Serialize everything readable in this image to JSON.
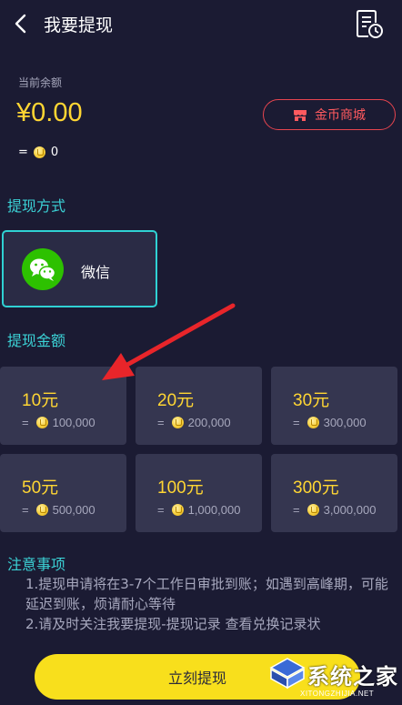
{
  "header": {
    "title": "我要提现",
    "back_icon": "chevron-left-icon",
    "record_icon": "records-clock-icon"
  },
  "balance": {
    "label": "当前余额",
    "amount": "¥0.00",
    "coin_equals": "=",
    "coin_count": "0"
  },
  "shop_button": {
    "label": "金币商城",
    "icon": "store-icon"
  },
  "method_section": {
    "title": "提现方式",
    "options": [
      {
        "label": "微信",
        "icon": "wechat-icon",
        "selected": true
      }
    ]
  },
  "amount_section": {
    "title": "提现金额",
    "options": [
      {
        "value": "10元",
        "equals": "=",
        "coins": "100,000"
      },
      {
        "value": "20元",
        "equals": "=",
        "coins": "200,000"
      },
      {
        "value": "30元",
        "equals": "=",
        "coins": "300,000"
      },
      {
        "value": "50元",
        "equals": "=",
        "coins": "500,000"
      },
      {
        "value": "100元",
        "equals": "=",
        "coins": "1,000,000"
      },
      {
        "value": "300元",
        "equals": "=",
        "coins": "3,000,000"
      }
    ]
  },
  "notes": {
    "title": "注意事项",
    "line1": "1.提现申请将在3-7个工作日审批到账；如遇到高峰期，可能延迟到账，烦请耐心等待",
    "line2": "2.请及时关注我要提现-提现记录 查看兑换记录状"
  },
  "withdraw_button": {
    "label": "立刻提现"
  },
  "watermark": {
    "text": "系统之家",
    "url": "XITONGZHIJIA.NET"
  },
  "colors": {
    "background": "#1b1b33",
    "accent_cyan": "#3bd1d5",
    "accent_yellow": "#ffd633",
    "button_yellow": "#f8df1c",
    "shop_red": "#e8454f",
    "wechat_green": "#2dc100",
    "arrow_red": "#e8252a"
  }
}
